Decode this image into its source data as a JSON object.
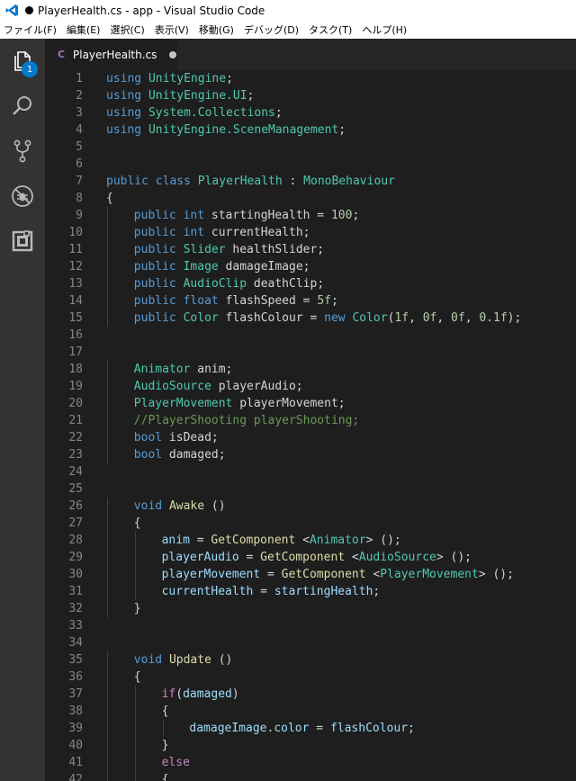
{
  "window": {
    "title": "PlayerHealth.cs - app - Visual Studio Code"
  },
  "menu": [
    "ファイル(F)",
    "編集(E)",
    "選択(C)",
    "表示(V)",
    "移動(G)",
    "デバッグ(D)",
    "タスク(T)",
    "ヘルプ(H)"
  ],
  "activity_bar": {
    "items": [
      {
        "name": "explorer",
        "icon": "files-icon",
        "badge": "1"
      },
      {
        "name": "search",
        "icon": "search-icon"
      },
      {
        "name": "source-control",
        "icon": "source-control-icon"
      },
      {
        "name": "debug",
        "icon": "debug-icon"
      },
      {
        "name": "extensions",
        "icon": "extensions-icon"
      }
    ]
  },
  "tab": {
    "icon": "C",
    "label": "PlayerHealth.cs",
    "modified": true
  },
  "colors": {
    "keyword": "#569cd6",
    "type": "#4ec9b0",
    "function": "#dcdcaa",
    "number": "#b5cea8",
    "comment": "#6a9955",
    "variable": "#9cdcfe",
    "control": "#c586c0",
    "plain": "#d4d4d4",
    "line_number": "#858585"
  },
  "lines": [
    {
      "n": "1",
      "indent": 0,
      "tokens": [
        [
          "kw",
          "using"
        ],
        [
          "pl",
          " "
        ],
        [
          "ns",
          "UnityEngine"
        ],
        [
          "pl",
          ";"
        ]
      ]
    },
    {
      "n": "2",
      "indent": 0,
      "tokens": [
        [
          "kw",
          "using"
        ],
        [
          "pl",
          " "
        ],
        [
          "ns",
          "UnityEngine.UI"
        ],
        [
          "pl",
          ";"
        ]
      ]
    },
    {
      "n": "3",
      "indent": 0,
      "tokens": [
        [
          "kw",
          "using"
        ],
        [
          "pl",
          " "
        ],
        [
          "ns",
          "System.Collections"
        ],
        [
          "pl",
          ";"
        ]
      ]
    },
    {
      "n": "4",
      "indent": 0,
      "tokens": [
        [
          "kw",
          "using"
        ],
        [
          "pl",
          " "
        ],
        [
          "ns",
          "UnityEngine.SceneManagement"
        ],
        [
          "pl",
          ";"
        ]
      ]
    },
    {
      "n": "5",
      "indent": 0,
      "tokens": []
    },
    {
      "n": "6",
      "indent": 0,
      "tokens": []
    },
    {
      "n": "7",
      "indent": 0,
      "tokens": [
        [
          "kw",
          "public"
        ],
        [
          "pl",
          " "
        ],
        [
          "kw",
          "class"
        ],
        [
          "pl",
          " "
        ],
        [
          "ty",
          "PlayerHealth"
        ],
        [
          "pl",
          " : "
        ],
        [
          "ty",
          "MonoBehaviour"
        ]
      ]
    },
    {
      "n": "8",
      "indent": 0,
      "tokens": [
        [
          "pl",
          "{"
        ]
      ]
    },
    {
      "n": "9",
      "indent": 1,
      "tokens": [
        [
          "kw",
          "public"
        ],
        [
          "pl",
          " "
        ],
        [
          "kw",
          "int"
        ],
        [
          "pl",
          " startingHealth = "
        ],
        [
          "num",
          "100"
        ],
        [
          "pl",
          ";"
        ]
      ]
    },
    {
      "n": "10",
      "indent": 1,
      "tokens": [
        [
          "kw",
          "public"
        ],
        [
          "pl",
          " "
        ],
        [
          "kw",
          "int"
        ],
        [
          "pl",
          " currentHealth;"
        ]
      ]
    },
    {
      "n": "11",
      "indent": 1,
      "tokens": [
        [
          "kw",
          "public"
        ],
        [
          "pl",
          " "
        ],
        [
          "ty",
          "Slider"
        ],
        [
          "pl",
          " healthSlider;"
        ]
      ]
    },
    {
      "n": "12",
      "indent": 1,
      "tokens": [
        [
          "kw",
          "public"
        ],
        [
          "pl",
          " "
        ],
        [
          "ty",
          "Image"
        ],
        [
          "pl",
          " damageImage;"
        ]
      ]
    },
    {
      "n": "13",
      "indent": 1,
      "tokens": [
        [
          "kw",
          "public"
        ],
        [
          "pl",
          " "
        ],
        [
          "ty",
          "AudioClip"
        ],
        [
          "pl",
          " deathClip;"
        ]
      ]
    },
    {
      "n": "14",
      "indent": 1,
      "tokens": [
        [
          "kw",
          "public"
        ],
        [
          "pl",
          " "
        ],
        [
          "kw",
          "float"
        ],
        [
          "pl",
          " flashSpeed = "
        ],
        [
          "num",
          "5f"
        ],
        [
          "pl",
          ";"
        ]
      ]
    },
    {
      "n": "15",
      "indent": 1,
      "tokens": [
        [
          "kw",
          "public"
        ],
        [
          "pl",
          " "
        ],
        [
          "ty",
          "Color"
        ],
        [
          "pl",
          " flashColour = "
        ],
        [
          "kw",
          "new"
        ],
        [
          "pl",
          " "
        ],
        [
          "ty",
          "Color"
        ],
        [
          "pl",
          "("
        ],
        [
          "num",
          "1f"
        ],
        [
          "pl",
          ", "
        ],
        [
          "num",
          "0f"
        ],
        [
          "pl",
          ", "
        ],
        [
          "num",
          "0f"
        ],
        [
          "pl",
          ", "
        ],
        [
          "num",
          "0.1f"
        ],
        [
          "pl",
          ");"
        ]
      ]
    },
    {
      "n": "16",
      "indent": 0,
      "tokens": []
    },
    {
      "n": "17",
      "indent": 0,
      "tokens": []
    },
    {
      "n": "18",
      "indent": 1,
      "tokens": [
        [
          "ty",
          "Animator"
        ],
        [
          "pl",
          " anim;"
        ]
      ]
    },
    {
      "n": "19",
      "indent": 1,
      "tokens": [
        [
          "ty",
          "AudioSource"
        ],
        [
          "pl",
          " playerAudio;"
        ]
      ]
    },
    {
      "n": "20",
      "indent": 1,
      "tokens": [
        [
          "ty",
          "PlayerMovement"
        ],
        [
          "pl",
          " playerMovement;"
        ]
      ]
    },
    {
      "n": "21",
      "indent": 1,
      "tokens": [
        [
          "cm",
          "//PlayerShooting playerShooting;"
        ]
      ]
    },
    {
      "n": "22",
      "indent": 1,
      "tokens": [
        [
          "kw",
          "bool"
        ],
        [
          "pl",
          " isDead;"
        ]
      ]
    },
    {
      "n": "23",
      "indent": 1,
      "tokens": [
        [
          "kw",
          "bool"
        ],
        [
          "pl",
          " damaged;"
        ]
      ]
    },
    {
      "n": "24",
      "indent": 0,
      "tokens": []
    },
    {
      "n": "25",
      "indent": 0,
      "tokens": []
    },
    {
      "n": "26",
      "indent": 1,
      "tokens": [
        [
          "kw",
          "void"
        ],
        [
          "pl",
          " "
        ],
        [
          "fn",
          "Awake"
        ],
        [
          "pl",
          " ()"
        ]
      ]
    },
    {
      "n": "27",
      "indent": 1,
      "tokens": [
        [
          "pl",
          "{"
        ]
      ]
    },
    {
      "n": "28",
      "indent": 2,
      "tokens": [
        [
          "var",
          "anim"
        ],
        [
          "pl",
          " = "
        ],
        [
          "fn",
          "GetComponent"
        ],
        [
          "pl",
          " <"
        ],
        [
          "ty",
          "Animator"
        ],
        [
          "pl",
          "> ();"
        ]
      ]
    },
    {
      "n": "29",
      "indent": 2,
      "tokens": [
        [
          "var",
          "playerAudio"
        ],
        [
          "pl",
          " = "
        ],
        [
          "fn",
          "GetComponent"
        ],
        [
          "pl",
          " <"
        ],
        [
          "ty",
          "AudioSource"
        ],
        [
          "pl",
          "> ();"
        ]
      ]
    },
    {
      "n": "30",
      "indent": 2,
      "tokens": [
        [
          "var",
          "playerMovement"
        ],
        [
          "pl",
          " = "
        ],
        [
          "fn",
          "GetComponent"
        ],
        [
          "pl",
          " <"
        ],
        [
          "ty",
          "PlayerMovement"
        ],
        [
          "pl",
          "> ();"
        ]
      ]
    },
    {
      "n": "31",
      "indent": 2,
      "tokens": [
        [
          "var",
          "currentHealth"
        ],
        [
          "pl",
          " = "
        ],
        [
          "var",
          "startingHealth"
        ],
        [
          "pl",
          ";"
        ]
      ]
    },
    {
      "n": "32",
      "indent": 1,
      "tokens": [
        [
          "pl",
          "}"
        ]
      ]
    },
    {
      "n": "33",
      "indent": 0,
      "tokens": []
    },
    {
      "n": "34",
      "indent": 0,
      "tokens": []
    },
    {
      "n": "35",
      "indent": 1,
      "tokens": [
        [
          "kw",
          "void"
        ],
        [
          "pl",
          " "
        ],
        [
          "fn",
          "Update"
        ],
        [
          "pl",
          " ()"
        ]
      ]
    },
    {
      "n": "36",
      "indent": 1,
      "tokens": [
        [
          "pl",
          "{"
        ]
      ]
    },
    {
      "n": "37",
      "indent": 2,
      "tokens": [
        [
          "ctl",
          "if"
        ],
        [
          "pl",
          "("
        ],
        [
          "var",
          "damaged"
        ],
        [
          "pl",
          ")"
        ]
      ]
    },
    {
      "n": "38",
      "indent": 2,
      "tokens": [
        [
          "pl",
          "{"
        ]
      ]
    },
    {
      "n": "39",
      "indent": 3,
      "tokens": [
        [
          "var",
          "damageImage"
        ],
        [
          "pl",
          "."
        ],
        [
          "var",
          "color"
        ],
        [
          "pl",
          " = "
        ],
        [
          "var",
          "flashColour"
        ],
        [
          "pl",
          ";"
        ]
      ]
    },
    {
      "n": "40",
      "indent": 2,
      "tokens": [
        [
          "pl",
          "}"
        ]
      ]
    },
    {
      "n": "41",
      "indent": 2,
      "tokens": [
        [
          "ctl",
          "else"
        ]
      ]
    },
    {
      "n": "42",
      "indent": 2,
      "tokens": [
        [
          "pl",
          "{"
        ]
      ]
    }
  ]
}
